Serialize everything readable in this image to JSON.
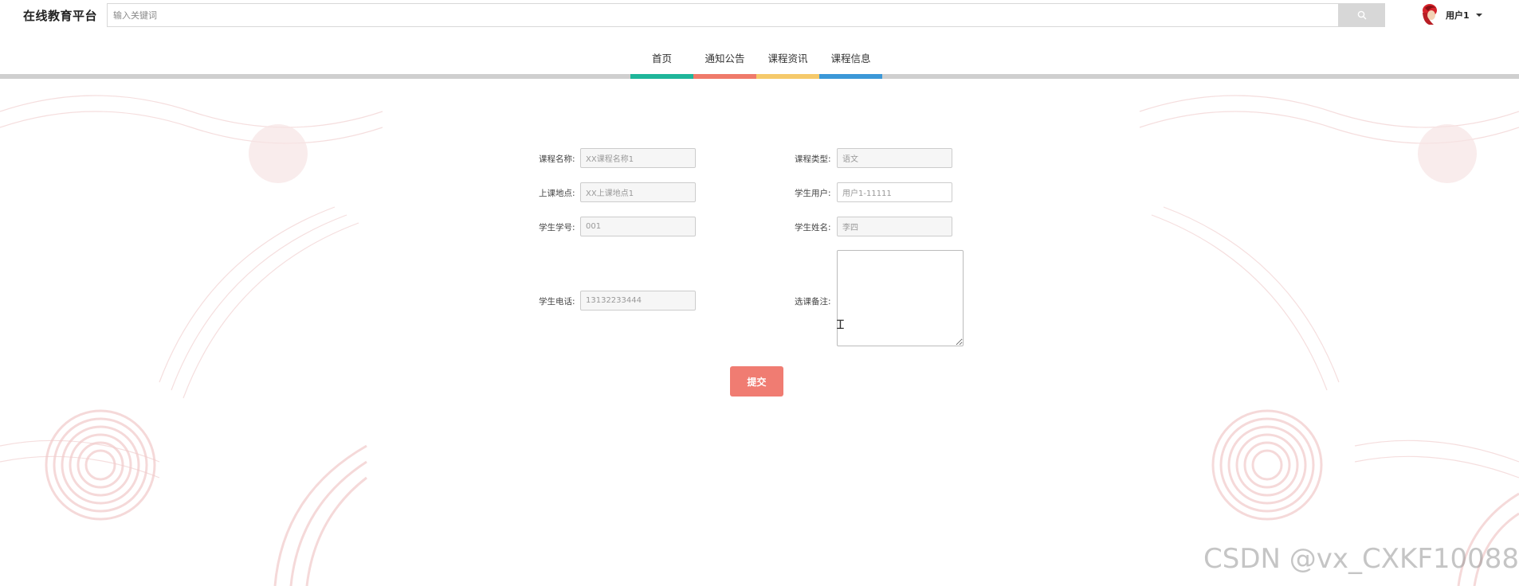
{
  "header": {
    "logo": "在线教育平台",
    "search_placeholder": "输入关键词",
    "user_name": "用户1"
  },
  "nav": {
    "items": [
      {
        "label": "首页",
        "color": "#1fb69a"
      },
      {
        "label": "通知公告",
        "color": "#ef7a6a"
      },
      {
        "label": "课程资讯",
        "color": "#f5c96a"
      },
      {
        "label": "课程信息",
        "color": "#3b98d8"
      }
    ]
  },
  "form": {
    "course_name": {
      "label": "课程名称:",
      "value": "XX课程名称1"
    },
    "course_type": {
      "label": "课程类型:",
      "value": "语文"
    },
    "location": {
      "label": "上课地点:",
      "value": "XX上课地点1"
    },
    "student_user": {
      "label": "学生用户:",
      "value": "用户1-11111"
    },
    "student_id": {
      "label": "学生学号:",
      "value": "001"
    },
    "student_name": {
      "label": "学生姓名:",
      "value": "李四"
    },
    "student_phone": {
      "label": "学生电话:",
      "value": "13132233444"
    },
    "remarks": {
      "label": "选课备注:",
      "value": ""
    },
    "submit_label": "提交"
  },
  "watermark": "CSDN @vx_CXKF10088"
}
